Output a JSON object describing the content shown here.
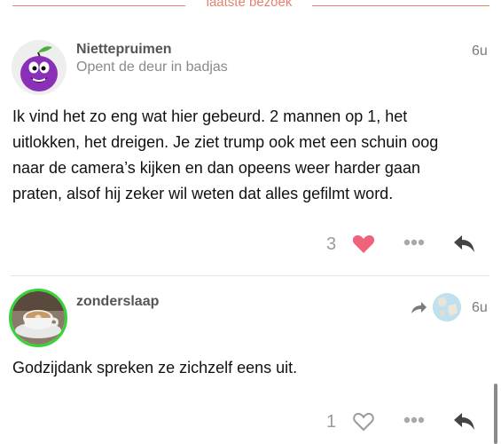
{
  "divider": {
    "label": "laatste bezoek"
  },
  "posts": [
    {
      "username": "Niettepruimen",
      "user_title": "Opent de deur in badjas",
      "time": "6u",
      "body_lines": [
        "Ik vind het zo eng wat hier gebeurd. 2 mannen op 1, het",
        "uitlokken, het dreigen. Je ziet trump ook met een schuin oog",
        "naar de camera’s kijken en dan opeens weer harder gaan",
        "praten, alsof hij zeker wil weten dat alles gefilmt word."
      ],
      "like_count": "3",
      "liked": true
    },
    {
      "username": "zonderslaap",
      "user_title": "",
      "time": "6u",
      "body_lines": [
        "Godzijdank spreken ze zichzelf eens uit."
      ],
      "like_count": "1",
      "liked": false
    }
  ],
  "colors": {
    "accent": "#e8806a",
    "like": "#f0627a",
    "online_ring": "#35d435"
  }
}
